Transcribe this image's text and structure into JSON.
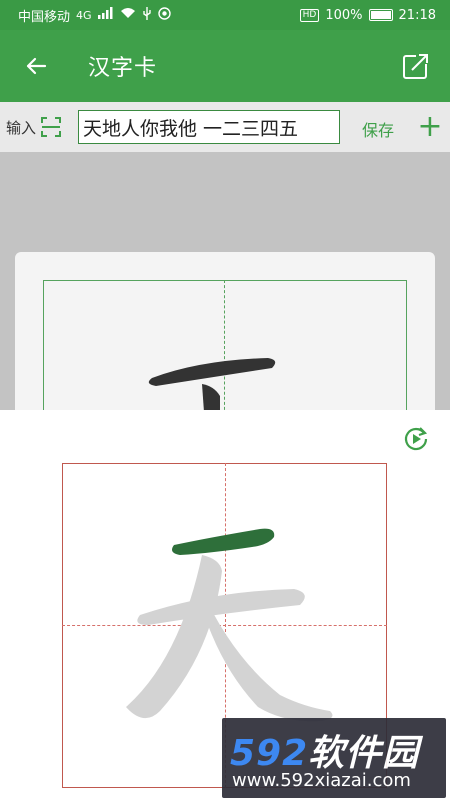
{
  "status_bar": {
    "carrier": "中国移动",
    "network": "4G",
    "battery": "100%",
    "time": "21:18",
    "hd": "HD"
  },
  "app_bar": {
    "title": "汉字卡"
  },
  "input_row": {
    "label": "输入",
    "value": "天地人你我他 一二三四五",
    "save_label": "保存",
    "add_label": "+"
  },
  "character": "天",
  "watermark": {
    "brand_num": "592",
    "brand_text": "软件园",
    "url": "www.592xiazai.com"
  },
  "colors": {
    "primary": "#3fa04a",
    "grid_red": "#c0584e",
    "stroke_active": "#2e6f3a",
    "stroke_ghost": "#d2d2d2"
  }
}
